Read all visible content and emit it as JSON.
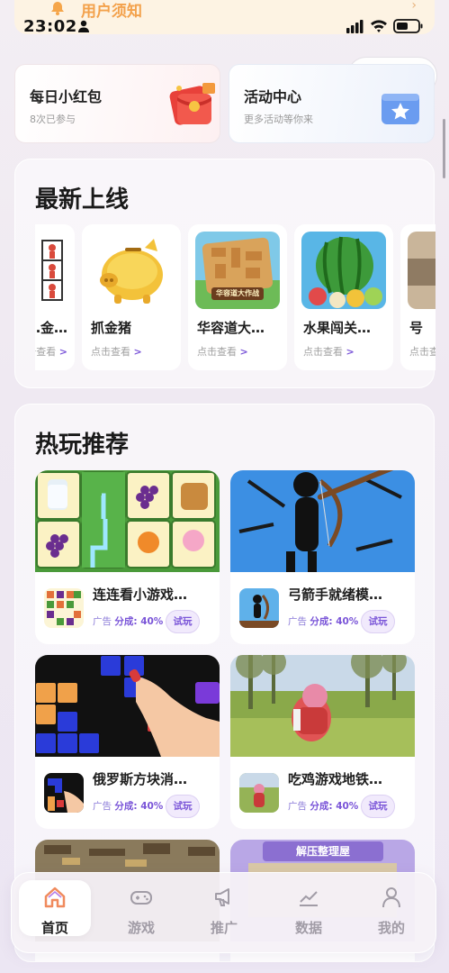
{
  "status_bar": {
    "time": "23:02"
  },
  "notice": {
    "text": "用户须知",
    "arrow": "›"
  },
  "top_cards": [
    {
      "title": "每日小红包",
      "subtitle": "8次已参与"
    },
    {
      "title": "活动中心",
      "subtitle": "更多活动等你来"
    }
  ],
  "capsule": {
    "more": "•••"
  },
  "new_section": {
    "title": "最新上线",
    "view_label": "点击查看",
    "view_arrow": ">",
    "items": [
      {
        "name": "…金…"
      },
      {
        "name": "抓金猪"
      },
      {
        "name": "华容道大…"
      },
      {
        "name": "水果闯关…"
      },
      {
        "name": "号"
      }
    ],
    "huarong_caption": "华容道大作战"
  },
  "hot_section": {
    "title": "热玩推荐",
    "ad_label": "广告",
    "share_label": "分成: 40%",
    "try_label": "试玩",
    "games": [
      {
        "name": "连连看小游戏…"
      },
      {
        "name": "弓箭手就绪模…"
      },
      {
        "name": "俄罗斯方块消…"
      },
      {
        "name": "吃鸡游戏地铁…"
      }
    ],
    "peek_caption": "解压整理屋"
  },
  "tabbar": {
    "tabs": [
      {
        "label": "首页",
        "icon": "home-icon",
        "active": true
      },
      {
        "label": "游戏",
        "icon": "gamepad-icon"
      },
      {
        "label": "推广",
        "icon": "megaphone-icon"
      },
      {
        "label": "数据",
        "icon": "chart-icon"
      },
      {
        "label": "我的",
        "icon": "user-icon"
      }
    ]
  },
  "colors": {
    "accent": "#7a55d8",
    "notice": "#f3a14b",
    "tab_active": "#f08a5d"
  }
}
